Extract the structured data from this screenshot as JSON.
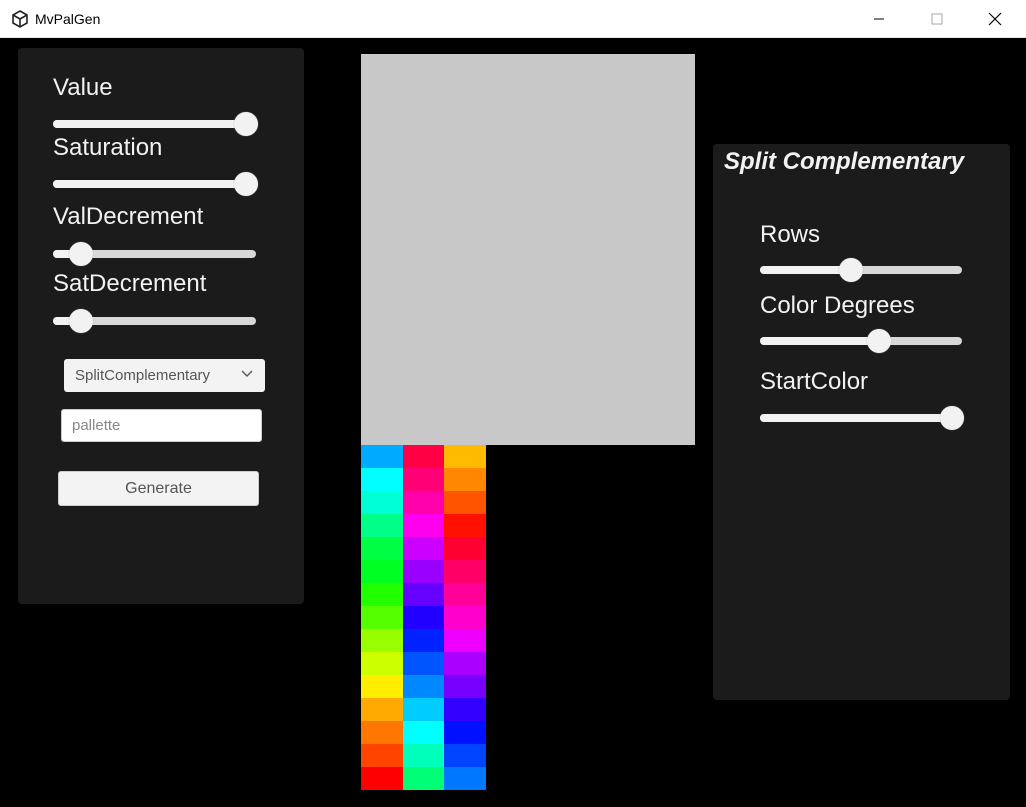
{
  "window": {
    "title": "MvPalGen"
  },
  "left_panel": {
    "sliders": [
      {
        "label": "Value",
        "fraction": 0.95
      },
      {
        "label": "Saturation",
        "fraction": 0.95
      },
      {
        "label": "ValDecrement",
        "fraction": 0.14
      },
      {
        "label": "SatDecrement",
        "fraction": 0.14
      }
    ],
    "dropdown": {
      "selected": "SplitComplementary"
    },
    "name_input": {
      "placeholder": "pallette",
      "value": ""
    },
    "generate_button": {
      "label": "Generate"
    }
  },
  "right_panel": {
    "title": "Split Complementary",
    "sliders": [
      {
        "label": "Rows",
        "fraction": 0.45
      },
      {
        "label": "Color Degrees",
        "fraction": 0.59
      },
      {
        "label": "StartColor",
        "fraction": 0.95
      }
    ]
  },
  "palette": {
    "preview_color": "#c8c8c8",
    "columns": [
      [
        "#00aaff",
        "#00ffff",
        "#00ffd5",
        "#00ff88",
        "#00ff44",
        "#00ff22",
        "#22ff00",
        "#55ff00",
        "#99ff00",
        "#ccff00",
        "#ffee00",
        "#ffaa00",
        "#ff7700",
        "#ff4400",
        "#ff0000"
      ],
      [
        "#ff0044",
        "#ff0077",
        "#ff00aa",
        "#ff00ee",
        "#cc00ff",
        "#9900ff",
        "#6600ff",
        "#2200ff",
        "#0022ff",
        "#0055ff",
        "#0088ff",
        "#00ccff",
        "#00ffff",
        "#00ffbb",
        "#00ff77"
      ],
      [
        "#ffbb00",
        "#ff8800",
        "#ff5500",
        "#ff1100",
        "#ff0033",
        "#ff0066",
        "#ff0099",
        "#ff00cc",
        "#ee00ff",
        "#aa00ff",
        "#7700ff",
        "#3300ff",
        "#0011ff",
        "#0044ff",
        "#0077ff"
      ]
    ]
  }
}
